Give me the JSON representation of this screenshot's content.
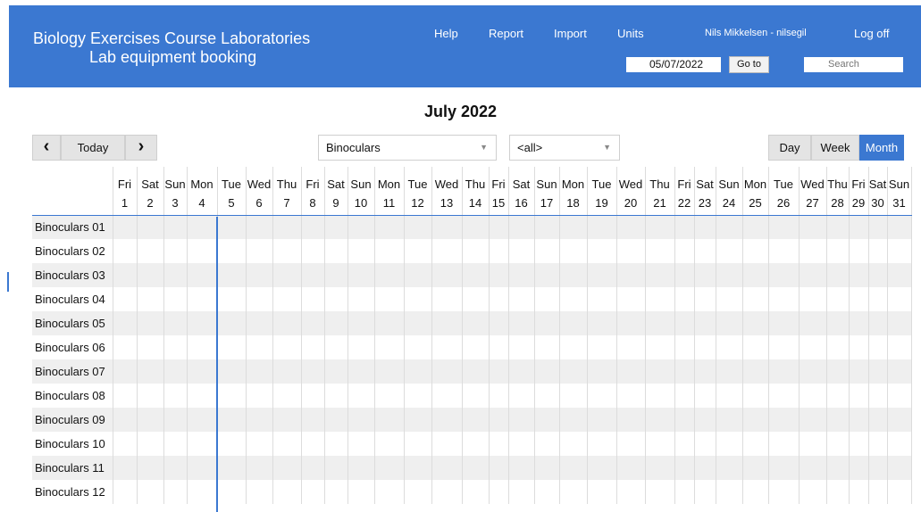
{
  "header": {
    "title": "Biology Exercises Course Laboratories",
    "subtitle": "Lab equipment booking",
    "nav": [
      "Help",
      "Report",
      "Import",
      "Units"
    ],
    "user": "Nils Mikkelsen - nilsegil",
    "logoff": "Log off",
    "date_value": "05/07/2022",
    "goto_label": "Go to",
    "search_placeholder": "Search"
  },
  "toolbar": {
    "month_title": "July 2022",
    "prev_icon": "‹",
    "today_label": "Today",
    "next_icon": "›",
    "resource_select": "Binoculars",
    "filter_select": "<all>",
    "views": [
      "Day",
      "Week",
      "Month"
    ],
    "active_view": "Month"
  },
  "calendar": {
    "weekdays": [
      "Fri",
      "Sat",
      "Sun",
      "Mon",
      "Tue",
      "Wed",
      "Thu",
      "Fri",
      "Sat",
      "Sun",
      "Mon",
      "Tue",
      "Wed",
      "Thu",
      "Fri",
      "Sat",
      "Sun",
      "Mon",
      "Tue",
      "Wed",
      "Thu",
      "Fri",
      "Sat",
      "Sun",
      "Mon",
      "Tue",
      "Wed",
      "Thu",
      "Fri",
      "Sat",
      "Sun"
    ],
    "days": [
      "1",
      "2",
      "3",
      "4",
      "5",
      "6",
      "7",
      "8",
      "9",
      "10",
      "11",
      "12",
      "13",
      "14",
      "15",
      "16",
      "17",
      "18",
      "19",
      "20",
      "21",
      "22",
      "23",
      "24",
      "25",
      "26",
      "27",
      "28",
      "29",
      "30",
      "31"
    ],
    "today_day": 5,
    "resources": [
      "Binoculars 01",
      "Binoculars 02",
      "Binoculars 03",
      "Binoculars 04",
      "Binoculars 05",
      "Binoculars 06",
      "Binoculars 07",
      "Binoculars 08",
      "Binoculars 09",
      "Binoculars 10",
      "Binoculars 11",
      "Binoculars 12"
    ]
  },
  "colors": {
    "accent": "#3b78d1",
    "stripe": "#efefef",
    "grid_line": "#dcdcdc"
  }
}
